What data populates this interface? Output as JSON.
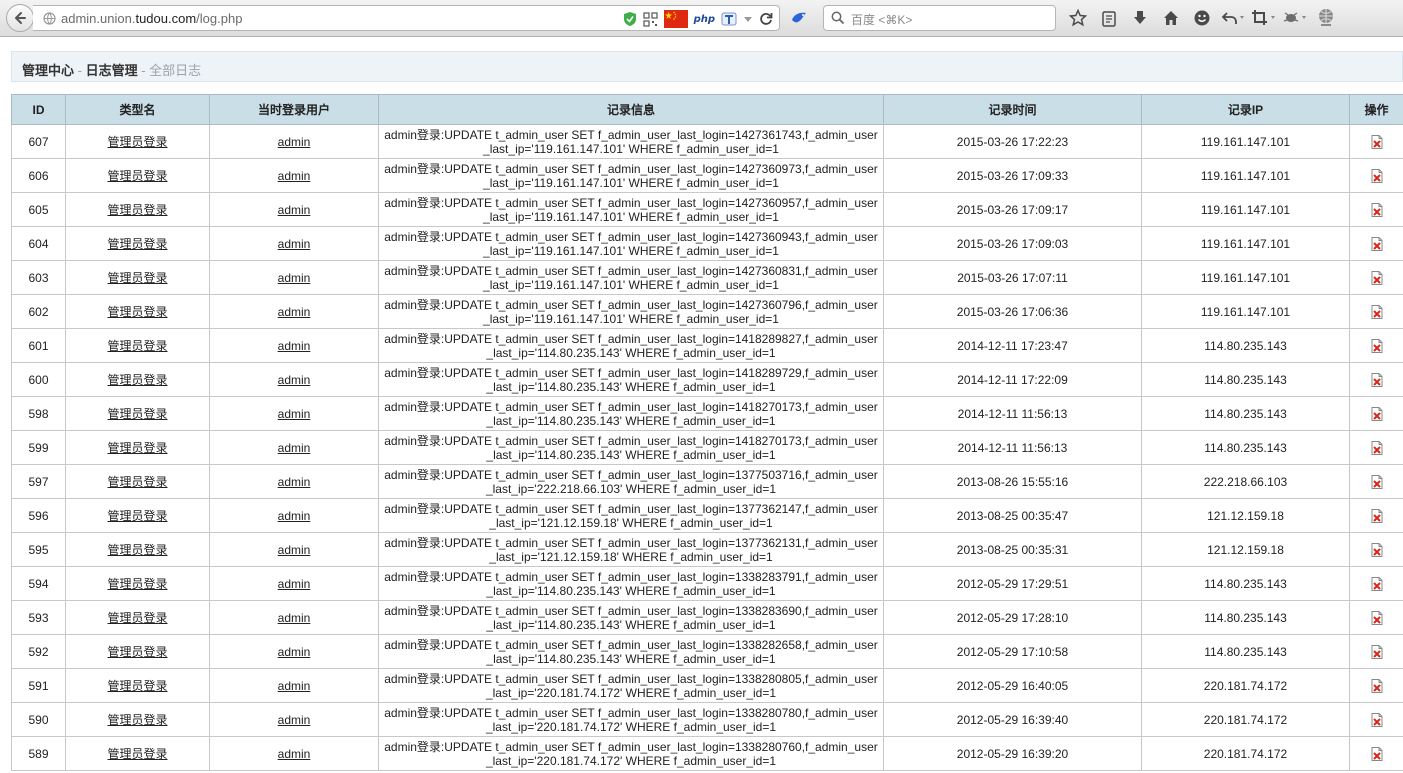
{
  "browser": {
    "url_host": "admin.union.",
    "url_domain": "tudou.com",
    "url_path": "/log.php",
    "search_placeholder": "百度 <⌘K>",
    "php_badge": "php"
  },
  "page": {
    "breadcrumb_home": "管理中心",
    "breadcrumb_sep1": " - ",
    "breadcrumb_section": "日志管理",
    "breadcrumb_sep2": " - ",
    "breadcrumb_current": "全部日志"
  },
  "table": {
    "headers": [
      "ID",
      "类型名",
      "当时登录用户",
      "记录信息",
      "记录时间",
      "记录IP",
      "操作"
    ],
    "rows": [
      {
        "id": "607",
        "type": "管理员登录",
        "user": "admin",
        "msg1": "admin登录:UPDATE t_admin_user SET f_admin_user_last_login=1427361743,f_admin_user",
        "msg2": "_last_ip='119.161.147.101' WHERE f_admin_user_id=1",
        "time": "2015-03-26 17:22:23",
        "ip": "119.161.147.101"
      },
      {
        "id": "606",
        "type": "管理员登录",
        "user": "admin",
        "msg1": "admin登录:UPDATE t_admin_user SET f_admin_user_last_login=1427360973,f_admin_user",
        "msg2": "_last_ip='119.161.147.101' WHERE f_admin_user_id=1",
        "time": "2015-03-26 17:09:33",
        "ip": "119.161.147.101"
      },
      {
        "id": "605",
        "type": "管理员登录",
        "user": "admin",
        "msg1": "admin登录:UPDATE t_admin_user SET f_admin_user_last_login=1427360957,f_admin_user",
        "msg2": "_last_ip='119.161.147.101' WHERE f_admin_user_id=1",
        "time": "2015-03-26 17:09:17",
        "ip": "119.161.147.101"
      },
      {
        "id": "604",
        "type": "管理员登录",
        "user": "admin",
        "msg1": "admin登录:UPDATE t_admin_user SET f_admin_user_last_login=1427360943,f_admin_user",
        "msg2": "_last_ip='119.161.147.101' WHERE f_admin_user_id=1",
        "time": "2015-03-26 17:09:03",
        "ip": "119.161.147.101"
      },
      {
        "id": "603",
        "type": "管理员登录",
        "user": "admin",
        "msg1": "admin登录:UPDATE t_admin_user SET f_admin_user_last_login=1427360831,f_admin_user",
        "msg2": "_last_ip='119.161.147.101' WHERE f_admin_user_id=1",
        "time": "2015-03-26 17:07:11",
        "ip": "119.161.147.101"
      },
      {
        "id": "602",
        "type": "管理员登录",
        "user": "admin",
        "msg1": "admin登录:UPDATE t_admin_user SET f_admin_user_last_login=1427360796,f_admin_user",
        "msg2": "_last_ip='119.161.147.101' WHERE f_admin_user_id=1",
        "time": "2015-03-26 17:06:36",
        "ip": "119.161.147.101"
      },
      {
        "id": "601",
        "type": "管理员登录",
        "user": "admin",
        "msg1": "admin登录:UPDATE t_admin_user SET f_admin_user_last_login=1418289827,f_admin_user",
        "msg2": "_last_ip='114.80.235.143' WHERE f_admin_user_id=1",
        "time": "2014-12-11 17:23:47",
        "ip": "114.80.235.143"
      },
      {
        "id": "600",
        "type": "管理员登录",
        "user": "admin",
        "msg1": "admin登录:UPDATE t_admin_user SET f_admin_user_last_login=1418289729,f_admin_user",
        "msg2": "_last_ip='114.80.235.143' WHERE f_admin_user_id=1",
        "time": "2014-12-11 17:22:09",
        "ip": "114.80.235.143"
      },
      {
        "id": "598",
        "type": "管理员登录",
        "user": "admin",
        "msg1": "admin登录:UPDATE t_admin_user SET f_admin_user_last_login=1418270173,f_admin_user",
        "msg2": "_last_ip='114.80.235.143' WHERE f_admin_user_id=1",
        "time": "2014-12-11 11:56:13",
        "ip": "114.80.235.143"
      },
      {
        "id": "599",
        "type": "管理员登录",
        "user": "admin",
        "msg1": "admin登录:UPDATE t_admin_user SET f_admin_user_last_login=1418270173,f_admin_user",
        "msg2": "_last_ip='114.80.235.143' WHERE f_admin_user_id=1",
        "time": "2014-12-11 11:56:13",
        "ip": "114.80.235.143"
      },
      {
        "id": "597",
        "type": "管理员登录",
        "user": "admin",
        "msg1": "admin登录:UPDATE t_admin_user SET f_admin_user_last_login=1377503716,f_admin_user",
        "msg2": "_last_ip='222.218.66.103' WHERE f_admin_user_id=1",
        "time": "2013-08-26 15:55:16",
        "ip": "222.218.66.103"
      },
      {
        "id": "596",
        "type": "管理员登录",
        "user": "admin",
        "msg1": "admin登录:UPDATE t_admin_user SET f_admin_user_last_login=1377362147,f_admin_user",
        "msg2": "_last_ip='121.12.159.18' WHERE f_admin_user_id=1",
        "time": "2013-08-25 00:35:47",
        "ip": "121.12.159.18"
      },
      {
        "id": "595",
        "type": "管理员登录",
        "user": "admin",
        "msg1": "admin登录:UPDATE t_admin_user SET f_admin_user_last_login=1377362131,f_admin_user",
        "msg2": "_last_ip='121.12.159.18' WHERE f_admin_user_id=1",
        "time": "2013-08-25 00:35:31",
        "ip": "121.12.159.18"
      },
      {
        "id": "594",
        "type": "管理员登录",
        "user": "admin",
        "msg1": "admin登录:UPDATE t_admin_user SET f_admin_user_last_login=1338283791,f_admin_user",
        "msg2": "_last_ip='114.80.235.143' WHERE f_admin_user_id=1",
        "time": "2012-05-29 17:29:51",
        "ip": "114.80.235.143"
      },
      {
        "id": "593",
        "type": "管理员登录",
        "user": "admin",
        "msg1": "admin登录:UPDATE t_admin_user SET f_admin_user_last_login=1338283690,f_admin_user",
        "msg2": "_last_ip='114.80.235.143' WHERE f_admin_user_id=1",
        "time": "2012-05-29 17:28:10",
        "ip": "114.80.235.143"
      },
      {
        "id": "592",
        "type": "管理员登录",
        "user": "admin",
        "msg1": "admin登录:UPDATE t_admin_user SET f_admin_user_last_login=1338282658,f_admin_user",
        "msg2": "_last_ip='114.80.235.143' WHERE f_admin_user_id=1",
        "time": "2012-05-29 17:10:58",
        "ip": "114.80.235.143"
      },
      {
        "id": "591",
        "type": "管理员登录",
        "user": "admin",
        "msg1": "admin登录:UPDATE t_admin_user SET f_admin_user_last_login=1338280805,f_admin_user",
        "msg2": "_last_ip='220.181.74.172' WHERE f_admin_user_id=1",
        "time": "2012-05-29 16:40:05",
        "ip": "220.181.74.172"
      },
      {
        "id": "590",
        "type": "管理员登录",
        "user": "admin",
        "msg1": "admin登录:UPDATE t_admin_user SET f_admin_user_last_login=1338280780,f_admin_user",
        "msg2": "_last_ip='220.181.74.172' WHERE f_admin_user_id=1",
        "time": "2012-05-29 16:39:40",
        "ip": "220.181.74.172"
      },
      {
        "id": "589",
        "type": "管理员登录",
        "user": "admin",
        "msg1": "admin登录:UPDATE t_admin_user SET f_admin_user_last_login=1338280760,f_admin_user",
        "msg2": "_last_ip='220.181.74.172' WHERE f_admin_user_id=1",
        "time": "2012-05-29 16:39:20",
        "ip": "220.181.74.172"
      }
    ]
  }
}
